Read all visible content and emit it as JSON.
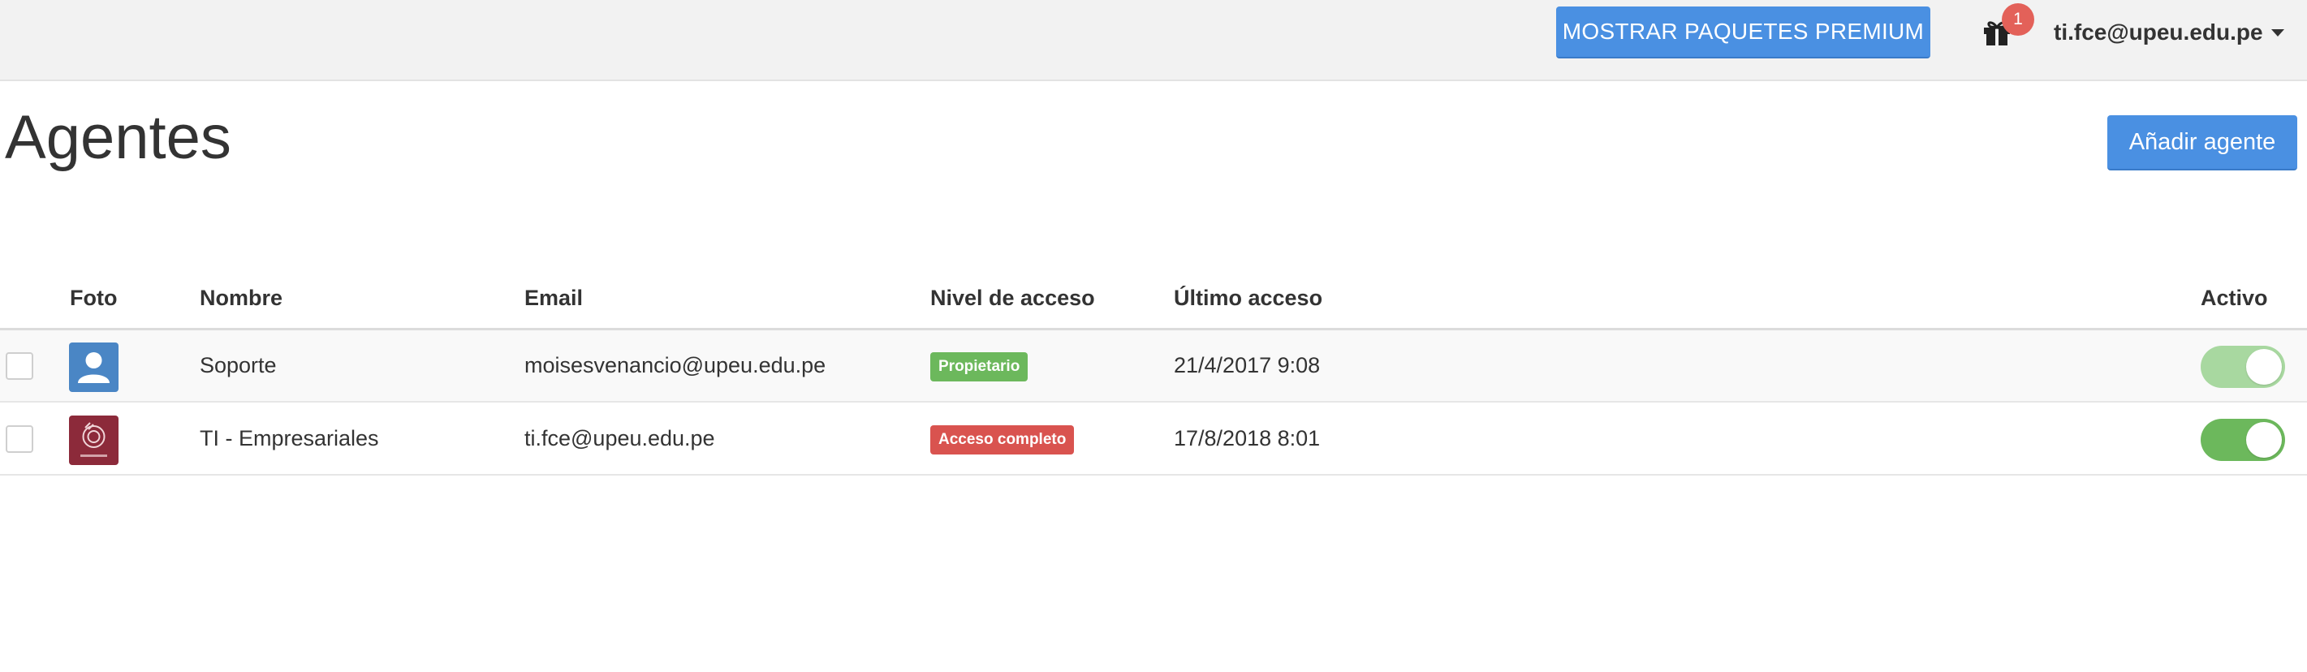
{
  "header": {
    "premium_button": "MOSTRAR PAQUETES PREMIUM",
    "gift_icon": "gift-icon",
    "gift_badge_count": "1",
    "user_email": "ti.fce@upeu.edu.pe",
    "user_menu_icon": "caret-down-icon"
  },
  "page": {
    "title": "Agentes",
    "add_button": "Añadir agente"
  },
  "table": {
    "columns": {
      "photo": "Foto",
      "name": "Nombre",
      "email": "Email",
      "access": "Nivel de acceso",
      "last_access": "Último acceso",
      "active": "Activo"
    },
    "rows": [
      {
        "name": "Soporte",
        "email": "moisesvenancio@upeu.edu.pe",
        "access": "Propietario",
        "last_access": "21/4/2017 9:08",
        "active": true,
        "avatar": "default-user-avatar"
      },
      {
        "name": "TI - Empresariales",
        "email": "ti.fce@upeu.edu.pe",
        "access": "Acceso completo",
        "last_access": "17/8/2018 8:01",
        "active": true,
        "avatar": "logo-avatar"
      }
    ]
  },
  "colors": {
    "primary": "#4a90e2",
    "owner_badge": "#6cb85c",
    "full_access_badge": "#d9534f",
    "toggle_disabled_on": "#a8d8a0",
    "toggle_on": "#6cb85c",
    "notification": "#e36159"
  }
}
